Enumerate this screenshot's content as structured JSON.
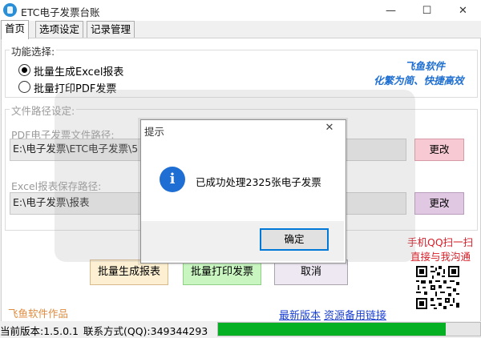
{
  "window": {
    "title": "ETC电子发票台账",
    "minimize": "—",
    "maximize": "☐",
    "close": "✕"
  },
  "tabs": [
    {
      "label": "首页",
      "active": true
    },
    {
      "label": "选项设定",
      "active": false
    },
    {
      "label": "记录管理",
      "active": false
    }
  ],
  "function_group": {
    "title": "功能选择:",
    "options": [
      {
        "label": "批量生成Excel报表",
        "selected": true
      },
      {
        "label": "批量打印PDF发票",
        "selected": false
      }
    ],
    "brand_name": "飞鱼软件",
    "brand_slogan": "化繁为简、快捷高效"
  },
  "path_group": {
    "title": "文件路径设定:",
    "pdf_label": "PDF电子发票文件路径:",
    "pdf_value": "E:\\电子发票\\ETC电子发票\\5",
    "pdf_change": "更改",
    "excel_label": "Excel报表保存路径:",
    "excel_value": "E:\\电子发票\\报表",
    "excel_change": "更改"
  },
  "actions": {
    "generate": "批量生成报表",
    "print": "批量打印发票",
    "cancel": "取消"
  },
  "contact": {
    "scan": "手机QQ扫一扫",
    "chat": "直接与我沟通"
  },
  "footer": {
    "credit": "飞鱼软件作品",
    "latest_link": "最新版本",
    "backup_link": "资源备用链接"
  },
  "status": {
    "version": "当前版本:1.5.0.1",
    "contact_qq": "联系方式(QQ):349344293",
    "progress": 0.87
  },
  "colors": {
    "progress": "#06b025",
    "brand": "#1f6fd1",
    "contact": "#d71e28",
    "link": "#1a3fd1"
  },
  "dialog": {
    "title": "提示",
    "close": "✕",
    "icon": "info-icon",
    "icon_glyph": "i",
    "message": "已成功处理2325张电子发票",
    "ok": "确定"
  }
}
